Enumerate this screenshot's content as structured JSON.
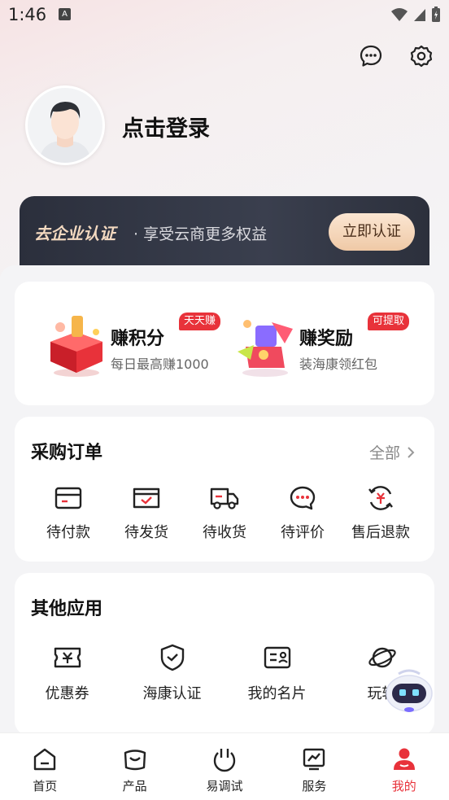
{
  "status_bar": {
    "time": "1:46",
    "a_badge": "A"
  },
  "header": {
    "login_text": "点击登录"
  },
  "cert_banner": {
    "title": "去企业认证",
    "subtitle": "· 享受云商更多权益",
    "button": "立即认证"
  },
  "rewards": [
    {
      "title": "赚积分",
      "subtitle": "每日最高赚1000",
      "badge": "天天赚"
    },
    {
      "title": "赚奖励",
      "subtitle": "装海康领红包",
      "badge": "可提取"
    }
  ],
  "orders": {
    "title": "采购订单",
    "more": "全部",
    "items": [
      {
        "label": "待付款",
        "icon": "wallet-card-icon"
      },
      {
        "label": "待发货",
        "icon": "package-check-icon"
      },
      {
        "label": "待收货",
        "icon": "truck-icon"
      },
      {
        "label": "待评价",
        "icon": "comment-icon"
      },
      {
        "label": "售后退款",
        "icon": "refund-icon"
      }
    ]
  },
  "apps": {
    "title": "其他应用",
    "items": [
      {
        "label": "优惠券",
        "icon": "coupon-icon"
      },
      {
        "label": "海康认证",
        "icon": "shield-check-icon"
      },
      {
        "label": "我的名片",
        "icon": "id-card-icon"
      },
      {
        "label": "玩转",
        "icon": "planet-icon"
      }
    ]
  },
  "tabs": [
    {
      "label": "首页",
      "icon": "home-icon"
    },
    {
      "label": "产品",
      "icon": "product-icon"
    },
    {
      "label": "易调试",
      "icon": "debug-icon"
    },
    {
      "label": "服务",
      "icon": "service-chart-icon"
    },
    {
      "label": "我的",
      "icon": "profile-icon",
      "active": true
    }
  ],
  "colors": {
    "accent": "#e8323a",
    "banner_dark": "#2b2f3c",
    "gold": "#efc9a6"
  }
}
